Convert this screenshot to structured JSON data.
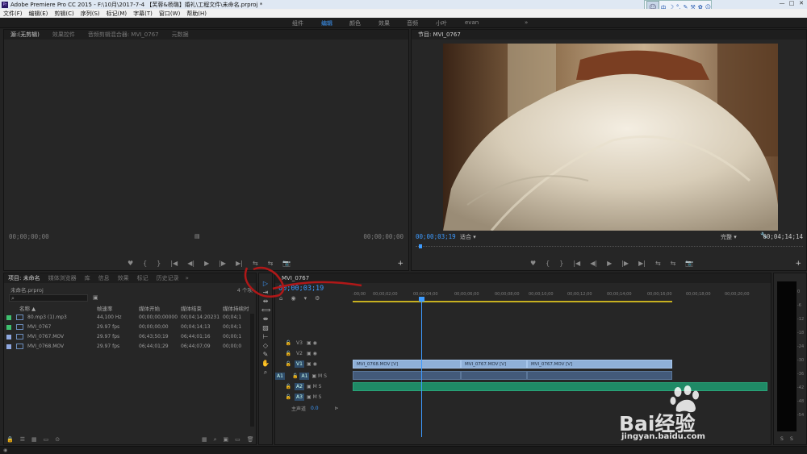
{
  "titlebar": {
    "app_icon": "Pr",
    "title": "Adobe Premiere Pro CC 2015 - F:\\10月\\2017-7-4 【芙蓉&杨璐】婚礼\\工程文件\\未命名.prproj *",
    "buttons": [
      "—",
      "□",
      "✕"
    ]
  },
  "menubar": {
    "items": [
      "文件(F)",
      "编辑(E)",
      "剪辑(C)",
      "序列(S)",
      "标记(M)",
      "字幕(T)",
      "窗口(W)",
      "帮助(H)"
    ]
  },
  "ime": {
    "avatar": "☺",
    "tools": [
      "中",
      "☽",
      "°,",
      "✎",
      "⚒",
      "✿",
      "☺"
    ]
  },
  "workspaces": {
    "items": [
      "组件",
      "编辑",
      "颜色",
      "效果",
      "音频",
      "小叶",
      "evan"
    ],
    "active": "编辑",
    "more": "»"
  },
  "source_panel": {
    "tabs": [
      "源:(无剪辑)",
      "效果控件",
      "音频剪辑混合器: MVI_0767",
      "元数据"
    ],
    "timecode_left": "00;00;00;00",
    "timecode_right": "00;00;00;00",
    "center_icon": "▤",
    "transport": [
      "♥",
      "{",
      "}",
      "|◀",
      "◀|",
      "▶",
      "|▶",
      "▶|",
      "⇆",
      "⇆",
      "📷"
    ],
    "add": "+"
  },
  "program_panel": {
    "tabs": [
      "节目: MVI_0767"
    ],
    "timecode_left": "00;00;03;19",
    "fit_label": "适合",
    "quality_label": "完整",
    "timecode_right": "00;04;14;14",
    "wrench": "🔧",
    "transport": [
      "♥",
      "{",
      "}",
      "|◀",
      "◀|",
      "▶",
      "|▶",
      "▶|",
      "⇆",
      "⇆",
      "📷"
    ],
    "add": "+"
  },
  "project_panel": {
    "tabs": [
      "项目: 未命名",
      "媒体浏览器",
      "库",
      "信息",
      "效果",
      "标记",
      "历史记录"
    ],
    "more": "»",
    "project_file": "未命名.prproj",
    "item_count": "4 个项",
    "search_icon": "⌕",
    "folder_icon": "▣",
    "columns": [
      "名称 ▲",
      "帧速率",
      "媒体开始",
      "媒体结束",
      "媒体持续时"
    ],
    "rows": [
      {
        "color": "#3fbf6f",
        "name": "80.mp3 (1).mp3",
        "rate": "44,100 Hz",
        "start": "00;00;00;00000",
        "end": "00;04;14:20231",
        "dur": "00;04;1"
      },
      {
        "color": "#3fbf6f",
        "name": "MVI_0767",
        "rate": "29.97 fps",
        "start": "00;00;00;00",
        "end": "00;04;14;13",
        "dur": "00;04;1"
      },
      {
        "color": "#8fa8e0",
        "name": "MVI_0767.MOV",
        "rate": "29.97 fps",
        "start": "06;43;50;19",
        "end": "06;44;01;16",
        "dur": "00;00;1"
      },
      {
        "color": "#8fa8e0",
        "name": "MVI_0768.MOV",
        "rate": "29.97 fps",
        "start": "06;44;01;29",
        "end": "06;44;07;09",
        "dur": "00;00;0"
      }
    ],
    "bottom_left": [
      "🔒",
      "☰",
      "▦",
      "▭",
      "⊙"
    ],
    "bottom_right": [
      "▦",
      "⌕",
      "▣",
      "▭",
      "🗑"
    ]
  },
  "tools": [
    "▷",
    "⇥",
    "⇹",
    "⟺",
    "⇼",
    "▨",
    "⊢",
    "◇",
    "✎",
    "✋",
    "⌕"
  ],
  "timeline": {
    "tab": "MVI_0767",
    "timecode": "00;00;03;19",
    "ruler": [
      ":00;00",
      "00;00;02;00",
      "00;00;04;00",
      "00;00;06;00",
      "00;00;08;00",
      "00;00;10;00",
      "00;00;12;00",
      "00;00;14;00",
      "00;00;16;00",
      "00;00;18;00",
      "00;00;20;00"
    ],
    "tracks": [
      {
        "id": "V3",
        "target": "",
        "buttons": "▣ ◉"
      },
      {
        "id": "V2",
        "target": "",
        "buttons": "▣ ◉"
      },
      {
        "id": "V1",
        "target": "",
        "buttons": "▣ ◉"
      },
      {
        "id": "A1",
        "target": "A1",
        "buttons": "▣ M S"
      },
      {
        "id": "A2",
        "target": "",
        "buttons": "▣ M S"
      },
      {
        "id": "A3",
        "target": "",
        "buttons": "▣ M S"
      }
    ],
    "master": {
      "label": "主声道",
      "value": "0.0"
    },
    "video_clips": [
      "MVI_0768.MOV [V]",
      "MVI_0767.MOV [V]",
      "MVI_0767.MOV [V]"
    ]
  },
  "meter": {
    "scale": [
      "0",
      "-6",
      "-12",
      "-18",
      "-24",
      "-30",
      "-36",
      "-42",
      "-48",
      "-54"
    ],
    "labels": [
      "S",
      "S"
    ]
  },
  "watermark": {
    "brand": "Bai经验",
    "url": "jingyan.baidu.com"
  }
}
